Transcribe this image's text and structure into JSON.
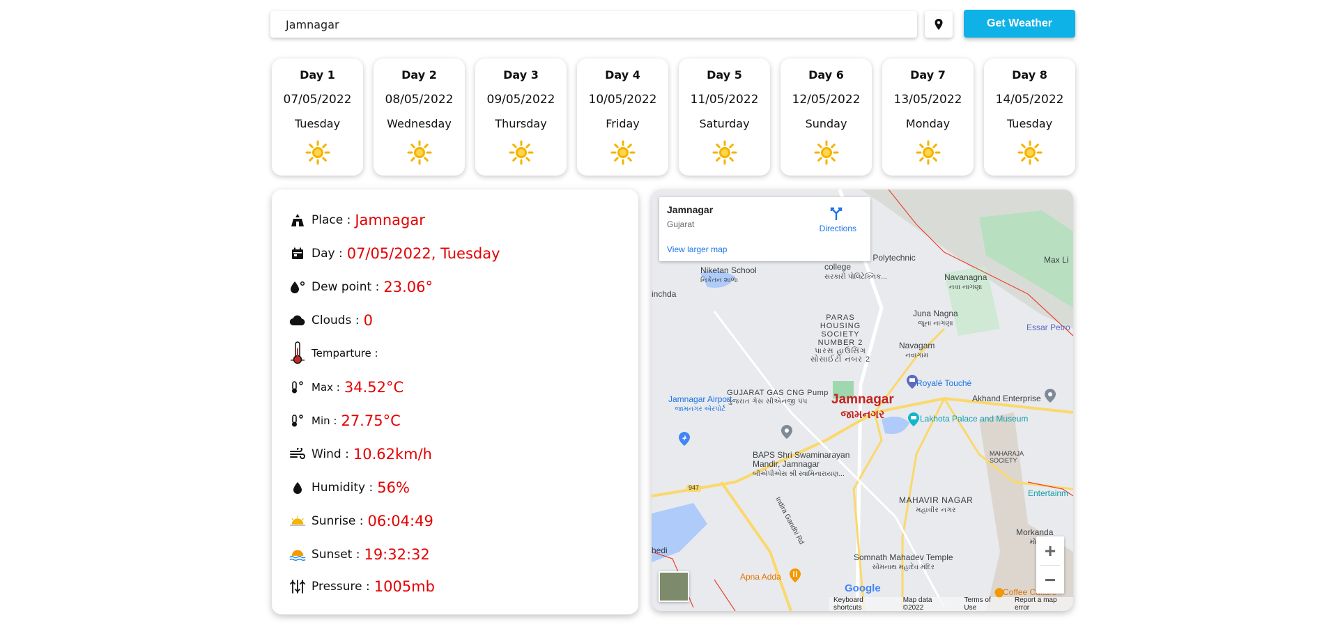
{
  "search": {
    "value": "Jamnagar",
    "button_label": "Get Weather"
  },
  "colors": {
    "accent": "#0fb2e6",
    "value_red": "#e60000",
    "sun": "#f4b400"
  },
  "days": [
    {
      "title": "Day 1",
      "date": "07/05/2022",
      "weekday": "Tuesday",
      "icon": "sun-icon"
    },
    {
      "title": "Day 2",
      "date": "08/05/2022",
      "weekday": "Wednesday",
      "icon": "sun-icon"
    },
    {
      "title": "Day 3",
      "date": "09/05/2022",
      "weekday": "Thursday",
      "icon": "sun-icon"
    },
    {
      "title": "Day 4",
      "date": "10/05/2022",
      "weekday": "Friday",
      "icon": "sun-icon"
    },
    {
      "title": "Day 5",
      "date": "11/05/2022",
      "weekday": "Saturday",
      "icon": "sun-icon"
    },
    {
      "title": "Day 6",
      "date": "12/05/2022",
      "weekday": "Sunday",
      "icon": "sun-icon"
    },
    {
      "title": "Day 7",
      "date": "13/05/2022",
      "weekday": "Monday",
      "icon": "sun-icon"
    },
    {
      "title": "Day 8",
      "date": "14/05/2022",
      "weekday": "Tuesday",
      "icon": "sun-icon"
    }
  ],
  "details": {
    "place": {
      "label": "Place :",
      "value": "Jamnagar"
    },
    "day": {
      "label": "Day :",
      "value": "07/05/2022, Tuesday"
    },
    "dew": {
      "label": "Dew point :",
      "value": "23.06°"
    },
    "clouds": {
      "label": "Clouds :",
      "value": "0"
    },
    "temperature": {
      "label": "Temparture :"
    },
    "max": {
      "label": "Max :",
      "value": "34.52°C"
    },
    "min": {
      "label": "Min :",
      "value": "27.75°C"
    },
    "wind": {
      "label": "Wind :",
      "value": "10.62km/h"
    },
    "humidity": {
      "label": "Humidity :",
      "value": "56%"
    },
    "sunrise": {
      "label": "Sunrise :",
      "value": "06:04:49"
    },
    "sunset": {
      "label": "Sunset :",
      "value": "19:32:32"
    },
    "pressure": {
      "label": "Pressure :",
      "value": "1005mb"
    }
  },
  "map": {
    "card_title": "Jamnagar",
    "card_subtitle": "Gujarat",
    "directions": "Directions",
    "larger_map": "View larger map",
    "zoom_in": "+",
    "zoom_out": "−",
    "labels": {
      "niketan": "Niketan School",
      "niketan_gu": "નિકેતન શાળા",
      "polytech": "Government Polytechnic college",
      "polytech_gu": "સરકારી પોલિટેક્નિક...",
      "navanagna": "Navanagna",
      "navanagna_gu": "નવા નાગણા",
      "maxli": "Max Li",
      "inchda": "inchda",
      "paras": "PARAS HOUSING SOCIETY NUMBER 2",
      "paras_gu": "પારસ હાઉસિંગ સોસાઈટી નંબર 2",
      "juna": "Juna Nagna",
      "juna_gu": "જૂના નાગણા",
      "essar": "Essar Petro",
      "navagam": "Navagam",
      "navagam_gu": "નવાગામ",
      "royale": "Royalé Touché",
      "gujarat_gas": "GUJARAT GAS CNG Pump",
      "gujarat_gas_gu": "ગુજરાત ગેસ સીએનજી પંપ",
      "airport": "Jamnagar Airport",
      "airport_gu": "જામનગર એરપોર્ટ",
      "city": "Jamnagar",
      "city_gu": "જામનગર",
      "lakhota": "Lakhota Palace and Museum",
      "akhand": "Akhand Enterprise",
      "baps": "BAPS Shri Swaminarayan Mandir, Jamnagar",
      "baps_gu": "બીએપીએસ શ્રી સ્વામિનારાયણ...",
      "maharaja": "MAHARAJA SOCIETY",
      "road947": "947",
      "entertainment": "Entertainm",
      "indira": "Indira Gandhi Rd",
      "mahavir": "MAHAVIR NAGAR",
      "mahavir_gu": "મહાવીર નગર",
      "morkanda": "Morkanda",
      "morkanda_gu": "મોર",
      "hedi": "hedi",
      "somnath": "Somnath Mahadev Temple",
      "somnath_gu": "સોમનાથ મહાદેવ મંદિર",
      "apna": "Apna Adda",
      "coffee": "Coffee Culture"
    },
    "footer": [
      "Keyboard shortcuts",
      "Map data ©2022",
      "Terms of Use",
      "Report a map error"
    ],
    "google": "Google"
  }
}
